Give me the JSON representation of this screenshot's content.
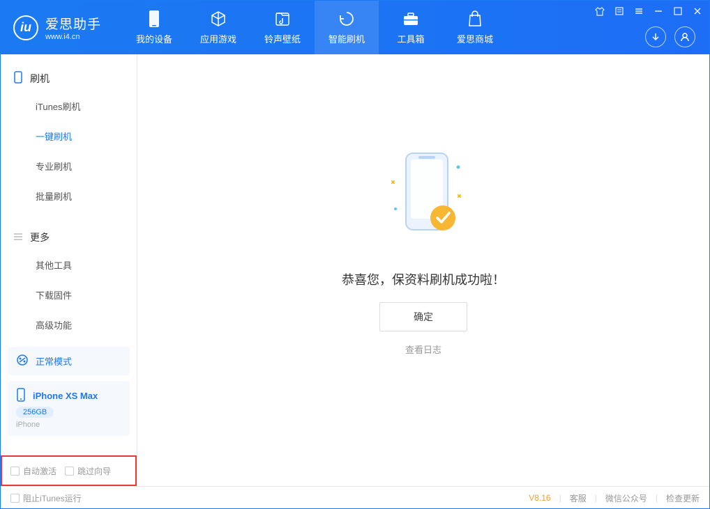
{
  "app": {
    "title": "爱思助手",
    "url": "www.i4.cn"
  },
  "nav": {
    "tabs": [
      {
        "label": "我的设备"
      },
      {
        "label": "应用游戏"
      },
      {
        "label": "铃声壁纸"
      },
      {
        "label": "智能刷机"
      },
      {
        "label": "工具箱"
      },
      {
        "label": "爱思商城"
      }
    ]
  },
  "sidebar": {
    "section1": {
      "title": "刷机",
      "items": [
        {
          "label": "iTunes刷机"
        },
        {
          "label": "一键刷机"
        },
        {
          "label": "专业刷机"
        },
        {
          "label": "批量刷机"
        }
      ]
    },
    "section2": {
      "title": "更多",
      "items": [
        {
          "label": "其他工具"
        },
        {
          "label": "下载固件"
        },
        {
          "label": "高级功能"
        }
      ]
    },
    "mode": {
      "label": "正常模式"
    },
    "device": {
      "name": "iPhone XS Max",
      "storage": "256GB",
      "type": "iPhone"
    },
    "options": {
      "autoActivate": "自动激活",
      "skipGuide": "跳过向导"
    }
  },
  "main": {
    "successTitle": "恭喜您，保资料刷机成功啦！",
    "confirmLabel": "确定",
    "viewLogLabel": "查看日志"
  },
  "footer": {
    "blockItunes": "阻止iTunes运行",
    "version": "V8.16",
    "links": [
      "客服",
      "微信公众号",
      "检查更新"
    ]
  }
}
